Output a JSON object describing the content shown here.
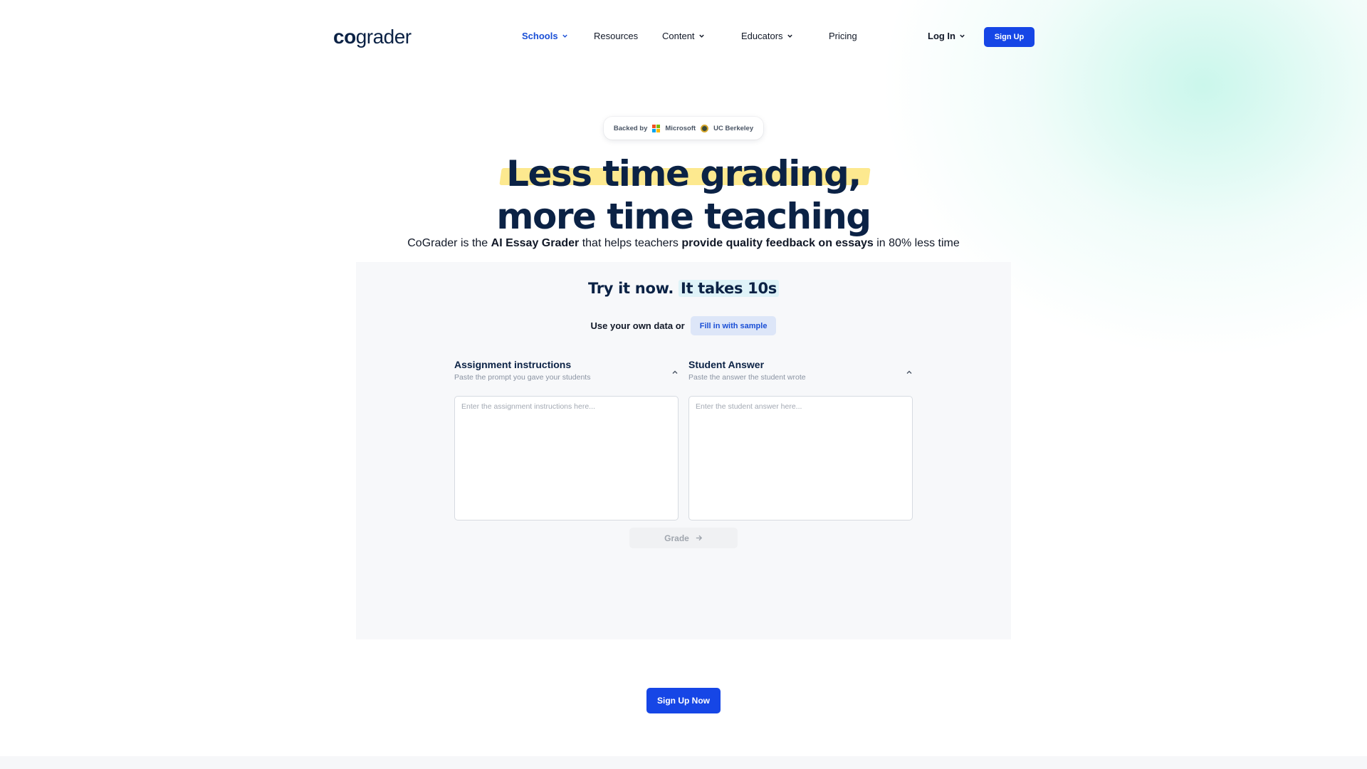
{
  "header": {
    "logo_co": "co",
    "logo_rest": "grader",
    "nav": [
      {
        "label": "Schools",
        "dropdown": true,
        "active": true
      },
      {
        "label": "Resources",
        "dropdown": false
      },
      {
        "label": "Content",
        "dropdown": true
      },
      {
        "label": "Educators",
        "dropdown": true
      },
      {
        "label": "Pricing",
        "dropdown": false
      }
    ],
    "login": "Log In",
    "signup": "Sign Up"
  },
  "badge": {
    "prefix": "Backed by",
    "partners": [
      "Microsoft",
      "UC Berkeley"
    ]
  },
  "hero": {
    "line1": "Less time grading",
    "comma": ",",
    "line2": "more time teaching",
    "subtitle": {
      "part1": "CoGrader is the ",
      "bold1": "AI Essay Grader",
      "part2": " that helps teachers ",
      "bold2": "provide quality feedback on essays",
      "part3": " in 80% less time"
    }
  },
  "try_panel": {
    "title_a": "Try it now.",
    "title_b": "It takes 10s",
    "use_label": "Use your own data or",
    "fill_button": "Fill in with sample",
    "assignment": {
      "title": "Assignment instructions",
      "hint": "Paste the prompt you gave your students",
      "placeholder": "Enter the assignment instructions here..."
    },
    "student": {
      "title": "Student Answer",
      "hint": "Paste the answer the student wrote",
      "placeholder": "Enter the student answer here..."
    },
    "grade_button": "Grade"
  },
  "cta": "Sign Up Now",
  "colors": {
    "brand_blue": "#1646e6",
    "navy": "#0b2245",
    "highlight_yellow": "#fde98f",
    "highlight_cyan": "#dff3f8"
  }
}
